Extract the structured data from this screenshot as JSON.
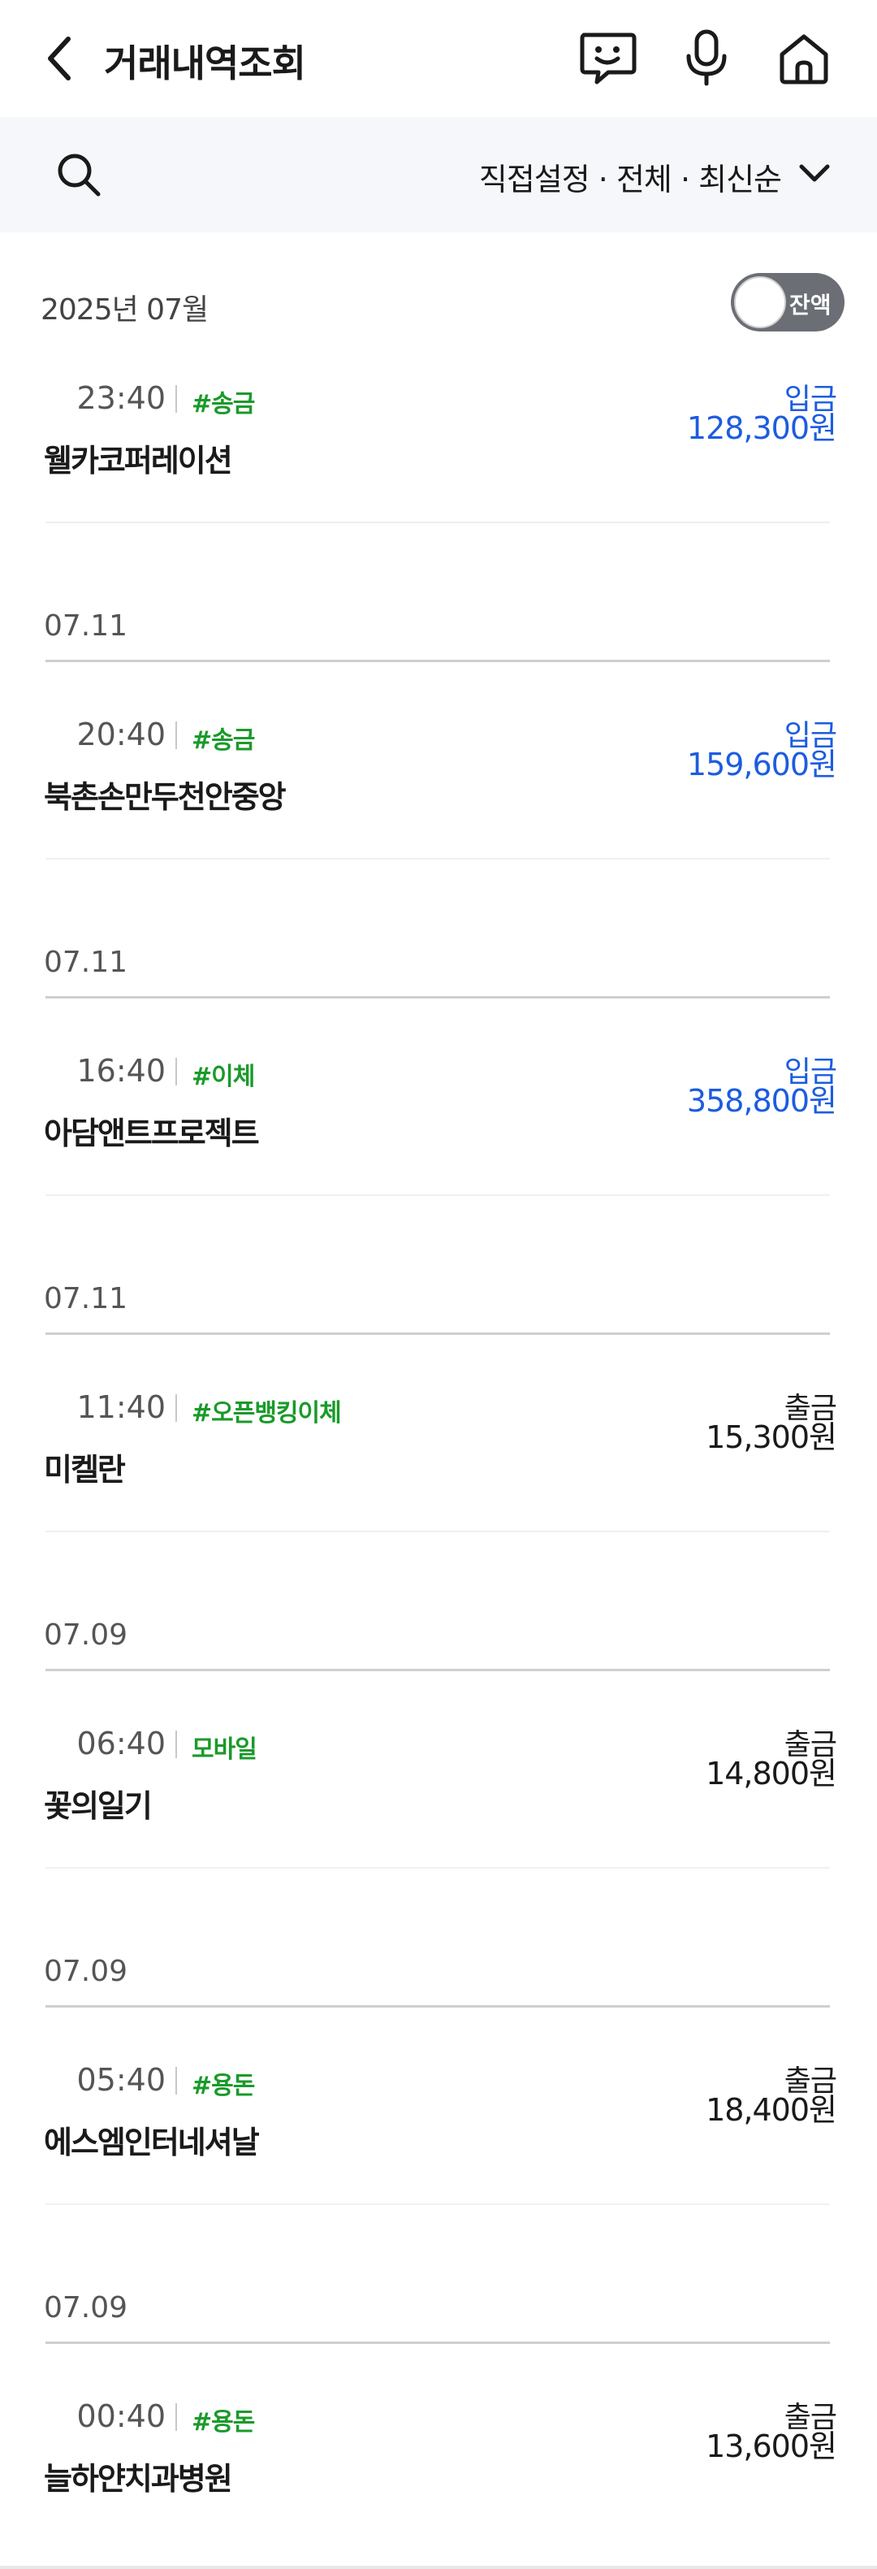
{
  "header": {
    "title": "거래내역조회",
    "icons": [
      "back-icon",
      "chat-icon",
      "mic-icon",
      "home-icon"
    ]
  },
  "filter": {
    "text": "직접설정 · 전체 · 최신순",
    "icons": [
      "search-icon",
      "chevron-down-icon"
    ]
  },
  "month": {
    "label": "2025년 07월",
    "toggle_label": "잔액"
  },
  "transactions": [
    {
      "time": "23:40",
      "tag": "#송금",
      "type": "입금",
      "amount": "128,300원",
      "name": "웰카코퍼레이션",
      "direction": "in"
    },
    {
      "time": "20:40",
      "tag": "#송금",
      "type": "입금",
      "amount": "159,600원",
      "name": "북촌손만두천안중앙",
      "direction": "in"
    },
    {
      "time": "16:40",
      "tag": "#이체",
      "type": "입금",
      "amount": "358,800원",
      "name": "아담앤트프로젝트",
      "direction": "in"
    },
    {
      "time": "11:40",
      "tag": "#오픈뱅킹이체",
      "type": "출금",
      "amount": "15,300원",
      "name": "미켈란",
      "direction": "out"
    },
    {
      "time": "06:40",
      "tag": "모바일",
      "type": "출금",
      "amount": "14,800원",
      "name": "꽃의일기",
      "direction": "out"
    },
    {
      "time": "05:40",
      "tag": "#용돈",
      "type": "출금",
      "amount": "18,400원",
      "name": "에스엠인터네셔날",
      "direction": "out"
    },
    {
      "time": "00:40",
      "tag": "#용돈",
      "type": "출금",
      "amount": "13,600원",
      "name": "늘하얀치과병원",
      "direction": "out"
    }
  ],
  "date_headers": [
    "07.11",
    "07.11",
    "07.11",
    "07.09",
    "07.09",
    "07.09"
  ],
  "colors": {
    "deposit": "#1c5ce0",
    "withdraw": "#1a1a1a",
    "tag": "#1a9a2a",
    "filter_bg": "#f5f7fa",
    "toggle_bg": "#6b6f75"
  }
}
